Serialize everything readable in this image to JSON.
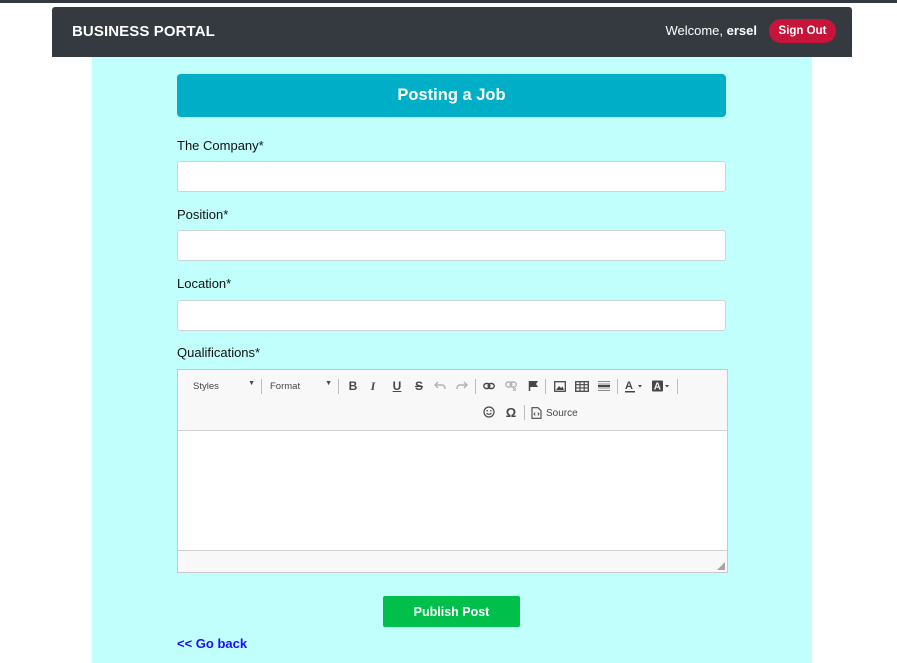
{
  "navbar": {
    "brand": "BUSINESS PORTAL",
    "welcome_prefix": "Welcome, ",
    "username": "ersel",
    "signout_label": "Sign Out"
  },
  "form": {
    "title": "Posting a Job",
    "fields": [
      {
        "label": "The Company*",
        "value": ""
      },
      {
        "label": "Position*",
        "value": ""
      },
      {
        "label": "Location*",
        "value": ""
      }
    ],
    "qualifications_label": "Qualifications*",
    "editor": {
      "styles_combo": "Styles",
      "format_combo": "Format",
      "source_label": "Source",
      "icons": [
        "bold-icon",
        "italic-icon",
        "underline-icon",
        "strikethrough-icon",
        "undo-icon",
        "redo-icon",
        "link-icon",
        "unlink-icon",
        "anchor-flag-icon",
        "image-icon",
        "table-icon",
        "horizontal-line-icon",
        "text-color-icon",
        "background-color-icon",
        "smiley-icon",
        "special-char-omega-icon",
        "source-icon"
      ]
    },
    "publish_label": "Publish Post",
    "go_back_label": "<< Go back"
  },
  "colors": {
    "navbar_bg": "#343a40",
    "signout_bg": "#c6143a",
    "content_bg": "#c1fffc",
    "header_bg": "#00aec7",
    "publish_bg": "#00c04b",
    "link": "#1a0dff"
  }
}
